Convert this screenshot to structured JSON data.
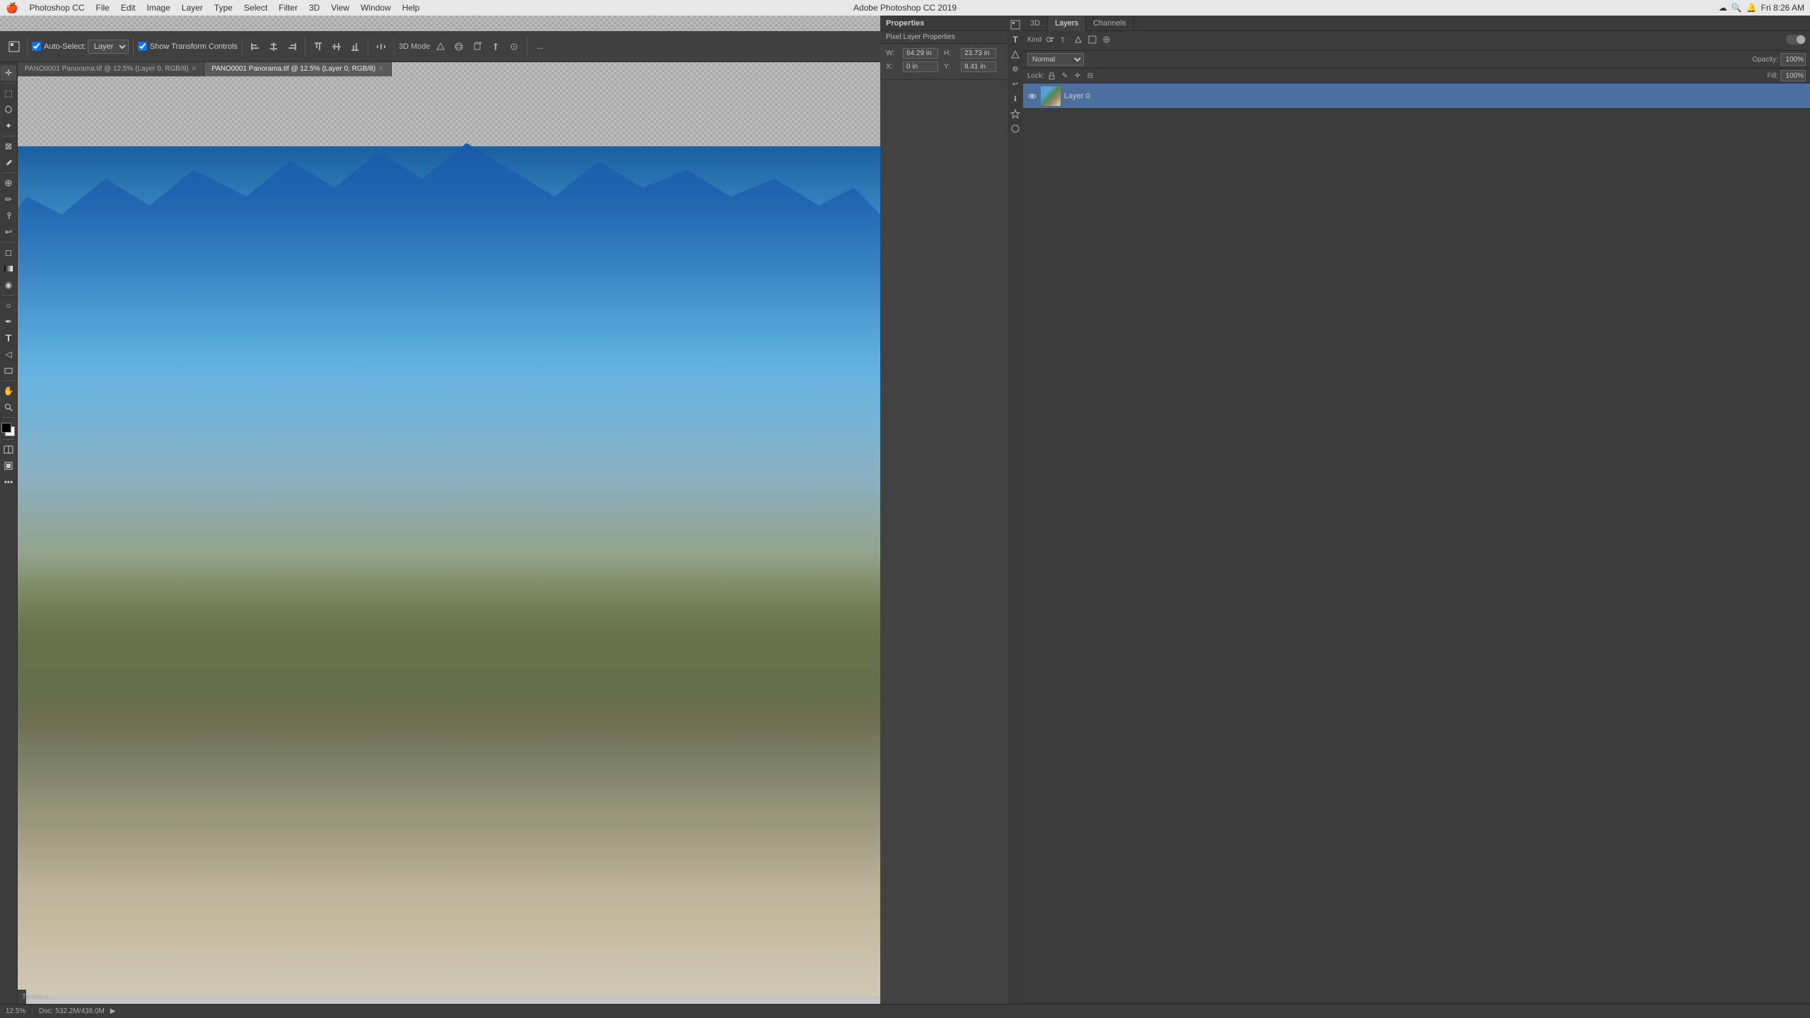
{
  "app": {
    "name": "Adobe Photoshop CC",
    "version": "2019",
    "title": "Adobe Photoshop CC 2019"
  },
  "menubar": {
    "apple_menu": "🍎",
    "app_label": "Photoshop CC",
    "menus": [
      "File",
      "Edit",
      "Image",
      "Layer",
      "Type",
      "Select",
      "Filter",
      "3D",
      "View",
      "Window",
      "Help"
    ],
    "time": "Fri 8:26 AM",
    "title": "Adobe Photoshop CC 2019"
  },
  "toolbar": {
    "move_tool": "⊹",
    "auto_select": "Auto-Select:",
    "auto_select_value": "Layer",
    "show_transform": "Show Transform Controls",
    "align_buttons": [
      "⊡",
      "⊟",
      "⊠",
      "⊢",
      "⊣",
      "⊤",
      "⊥"
    ],
    "mode_3d": "3D Mode",
    "more": "..."
  },
  "tabs": [
    {
      "id": "tab1",
      "label": "PANO0001 Panorama.tif @ 12.5% (Layer 0, RGB/8)",
      "active": false
    },
    {
      "id": "tab2",
      "label": "PANO0001 Panorama.tif @ 12.5% (Layer 0, RGB/8)",
      "active": true
    }
  ],
  "left_tools": [
    {
      "id": "move",
      "icon": "✛",
      "tooltip": "Move Tool"
    },
    {
      "id": "marquee",
      "icon": "⬚",
      "tooltip": "Marquee Tool"
    },
    {
      "id": "lasso",
      "icon": "⌖",
      "tooltip": "Lasso Tool"
    },
    {
      "id": "magic",
      "icon": "✦",
      "tooltip": "Quick Selection Tool"
    },
    {
      "id": "crop",
      "icon": "⊠",
      "tooltip": "Crop Tool"
    },
    {
      "id": "eyedropper",
      "icon": "⊕",
      "tooltip": "Eyedropper Tool"
    },
    {
      "id": "heal",
      "icon": "✚",
      "tooltip": "Healing Brush Tool"
    },
    {
      "id": "brush",
      "icon": "✏",
      "tooltip": "Brush Tool"
    },
    {
      "id": "clone",
      "icon": "⊕",
      "tooltip": "Clone Stamp Tool"
    },
    {
      "id": "history",
      "icon": "↩",
      "tooltip": "History Brush Tool"
    },
    {
      "id": "eraser",
      "icon": "◻",
      "tooltip": "Eraser Tool"
    },
    {
      "id": "gradient",
      "icon": "▣",
      "tooltip": "Gradient Tool"
    },
    {
      "id": "blur",
      "icon": "◉",
      "tooltip": "Blur Tool"
    },
    {
      "id": "dodge",
      "icon": "○",
      "tooltip": "Dodge Tool"
    },
    {
      "id": "pen",
      "icon": "✒",
      "tooltip": "Pen Tool"
    },
    {
      "id": "type",
      "icon": "T",
      "tooltip": "Type Tool"
    },
    {
      "id": "path",
      "icon": "◁",
      "tooltip": "Path Selection Tool"
    },
    {
      "id": "shape",
      "icon": "◻",
      "tooltip": "Shape Tool"
    },
    {
      "id": "hand",
      "icon": "✋",
      "tooltip": "Hand Tool"
    },
    {
      "id": "zoom",
      "icon": "⊕",
      "tooltip": "Zoom Tool"
    }
  ],
  "canvas": {
    "zoom": "12.5%",
    "doc_size": "Doc: 532.2M/438.0M",
    "filename": "PANO0001 Panorama.tif"
  },
  "properties_panel": {
    "title": "Properties",
    "subtitle": "Pixel Layer Properties",
    "width_label": "W:",
    "width_value": "64.29 in",
    "height_label": "H:",
    "height_value": "23.73 in",
    "x_label": "X:",
    "x_value": "0 in",
    "y_label": "Y:",
    "y_value": "8.41 in"
  },
  "layers_panel": {
    "title": "Layers",
    "tabs": [
      "3D",
      "Layers",
      "Channels"
    ],
    "active_tab": "Layers",
    "kind_label": "Kind",
    "blend_mode": "Normal",
    "opacity_label": "Opacity:",
    "opacity_value": "100%",
    "lock_label": "Lock:",
    "fill_label": "Fill:",
    "fill_value": "100%",
    "layers": [
      {
        "id": "layer0",
        "name": "Layer 0",
        "visible": true,
        "selected": true,
        "thumbnail_colors": [
          "#5a9fd4",
          "#4a8a5a"
        ]
      }
    ]
  },
  "statusbar": {
    "zoom": "12.5%",
    "doc_info": "Doc: 532.2M/438.0M",
    "timeline_label": "Timeline"
  },
  "right_icons": [
    {
      "id": "prop-icon-1",
      "icon": "⬛"
    },
    {
      "id": "prop-icon-2",
      "icon": "T"
    },
    {
      "id": "prop-icon-3",
      "icon": "◈"
    },
    {
      "id": "prop-icon-4",
      "icon": "⚙"
    },
    {
      "id": "prop-icon-5",
      "icon": "❏"
    },
    {
      "id": "prop-icon-6",
      "icon": "⚡"
    },
    {
      "id": "prop-icon-7",
      "icon": "✿"
    }
  ]
}
